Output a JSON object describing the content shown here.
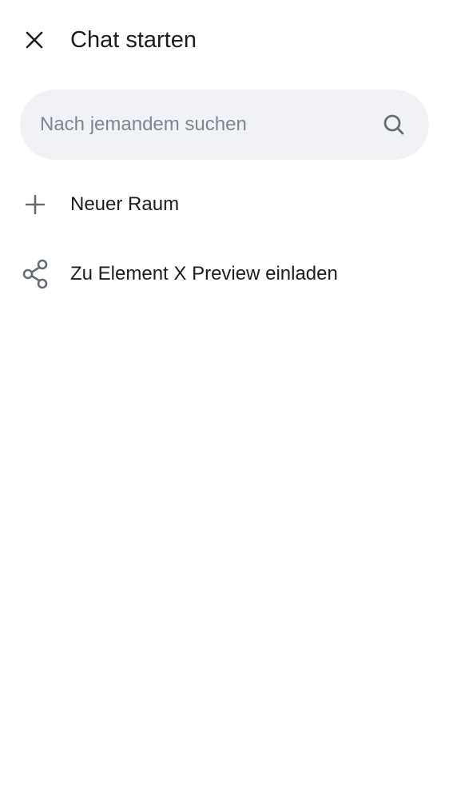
{
  "header": {
    "title": "Chat starten",
    "close_icon": "close-icon"
  },
  "search": {
    "placeholder": "Nach jemandem suchen",
    "value": "",
    "icon": "search-icon"
  },
  "actions": [
    {
      "label": "Neuer Raum",
      "icon": "plus-icon"
    },
    {
      "label": "Zu Element X Preview einladen",
      "icon": "share-icon"
    }
  ],
  "colors": {
    "background": "#ffffff",
    "text_primary": "#1b1d22",
    "text_secondary": "#7c8592",
    "icon": "#656d77",
    "search_background": "#f0f2f5"
  }
}
